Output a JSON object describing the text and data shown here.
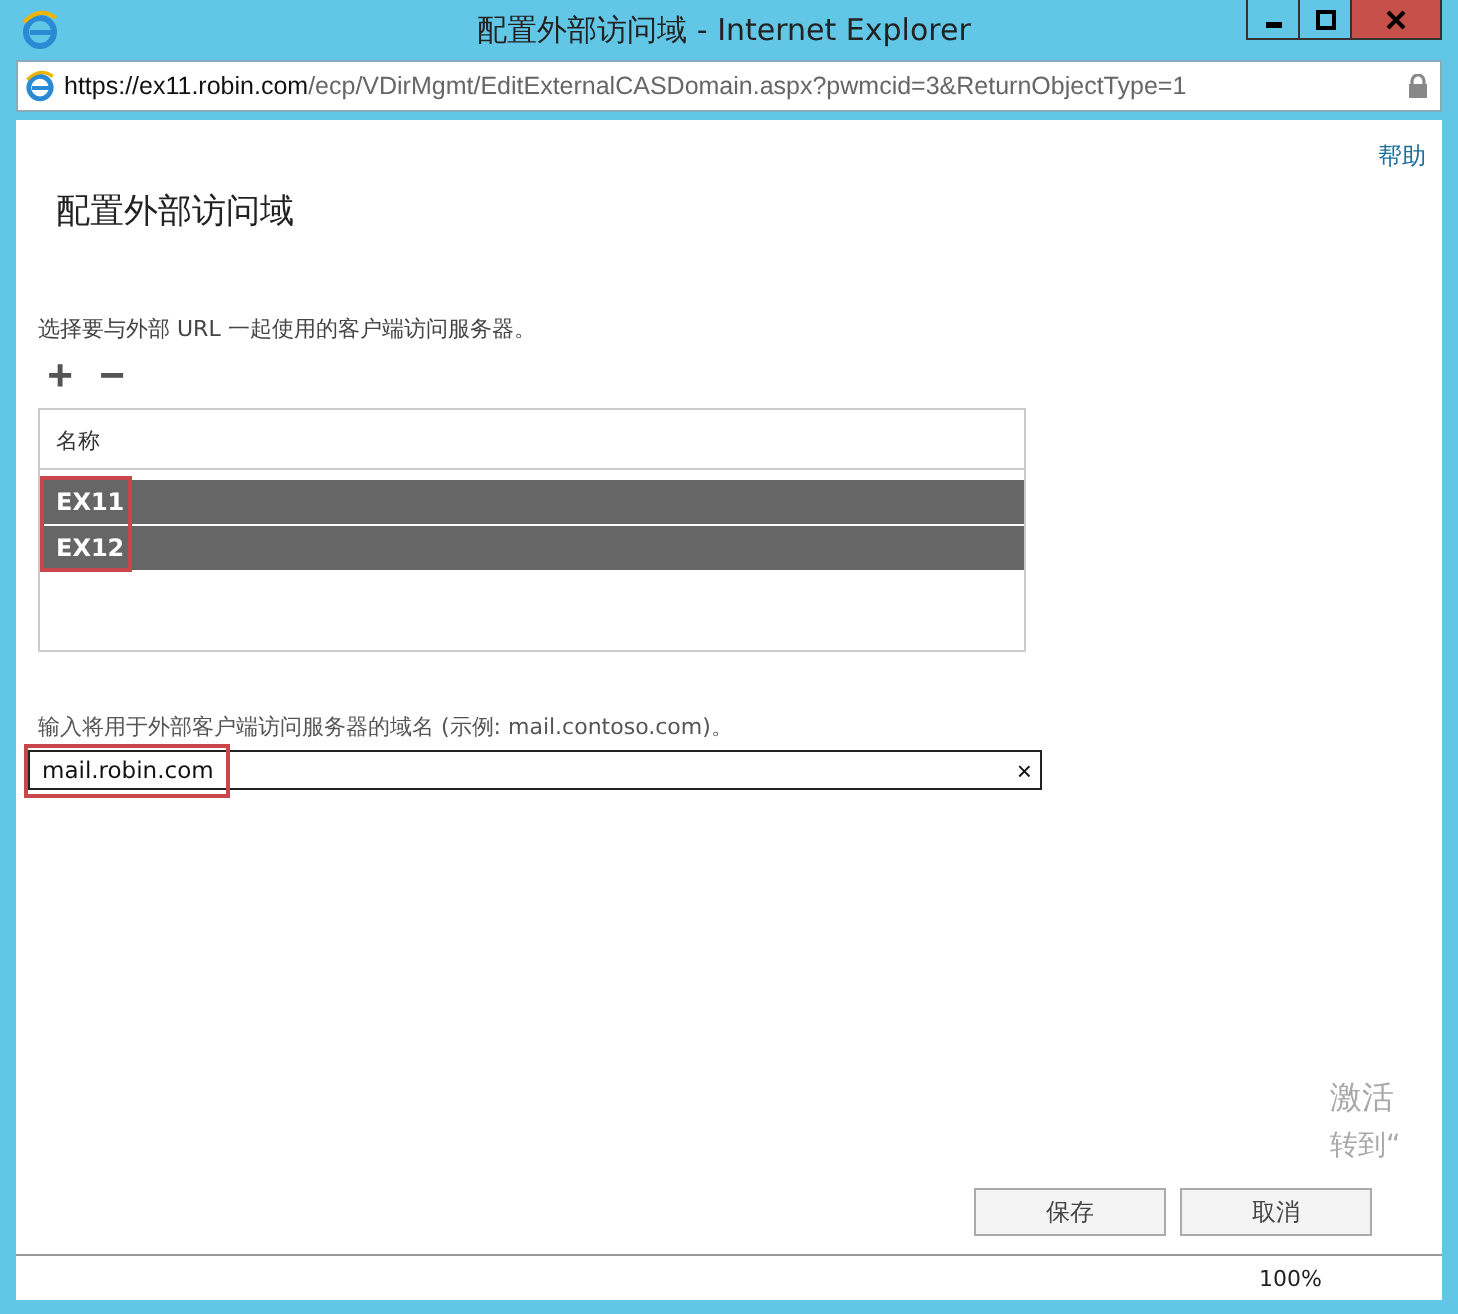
{
  "window": {
    "title": "配置外部访问域 - Internet Explorer"
  },
  "address_bar": {
    "url_host": "https://ex11.robin.com",
    "url_path": "/ecp/VDirMgmt/EditExternalCASDomain.aspx?pwmcid=3&ReturnObjectType=1"
  },
  "help_link": "帮助",
  "page_title": "配置外部访问域",
  "servers": {
    "instruction": "选择要与外部 URL 一起使用的客户端访问服务器。",
    "add": "+",
    "remove": "−",
    "column": "名称",
    "highlighted": true,
    "rows": [
      {
        "name": "EX11",
        "selected": true
      },
      {
        "name": "EX12",
        "selected": true
      }
    ]
  },
  "domain": {
    "label": "输入将用于外部客户端访问服务器的域名 (示例: mail.contoso.com)。",
    "value": "mail.robin.com",
    "clear": "×",
    "highlighted": true
  },
  "buttons": [
    {
      "label": "保存"
    },
    {
      "label": "取消"
    }
  ],
  "activation_notice": [
    "激活",
    "转到“"
  ],
  "status_bar": {
    "zoom": "100%"
  }
}
